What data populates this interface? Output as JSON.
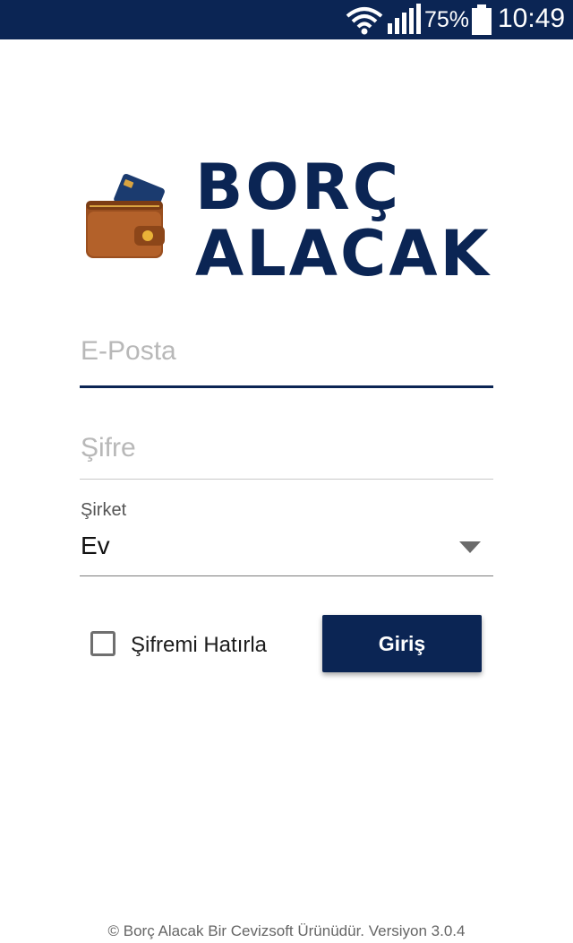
{
  "status_bar": {
    "battery_percent": "75%",
    "time": "10:49",
    "icons": [
      "wifi-icon",
      "signal-icon",
      "battery-icon"
    ],
    "background_color": "#0b2554"
  },
  "logo": {
    "line1": "BORÇ",
    "line2": "ALACAK",
    "icon": "wallet-icon",
    "color": "#0b2554"
  },
  "form": {
    "email_placeholder": "E-Posta",
    "password_placeholder": "Şifre",
    "company_label": "Şirket",
    "company_value": "Ev",
    "remember_label": "Şifremi Hatırla",
    "remember_checked": false,
    "login_label": "Giriş",
    "accent_color": "#0b2554"
  },
  "footer": {
    "text": "© Borç Alacak Bir Cevizsoft Ürünüdür. Versiyon 3.0.4"
  }
}
